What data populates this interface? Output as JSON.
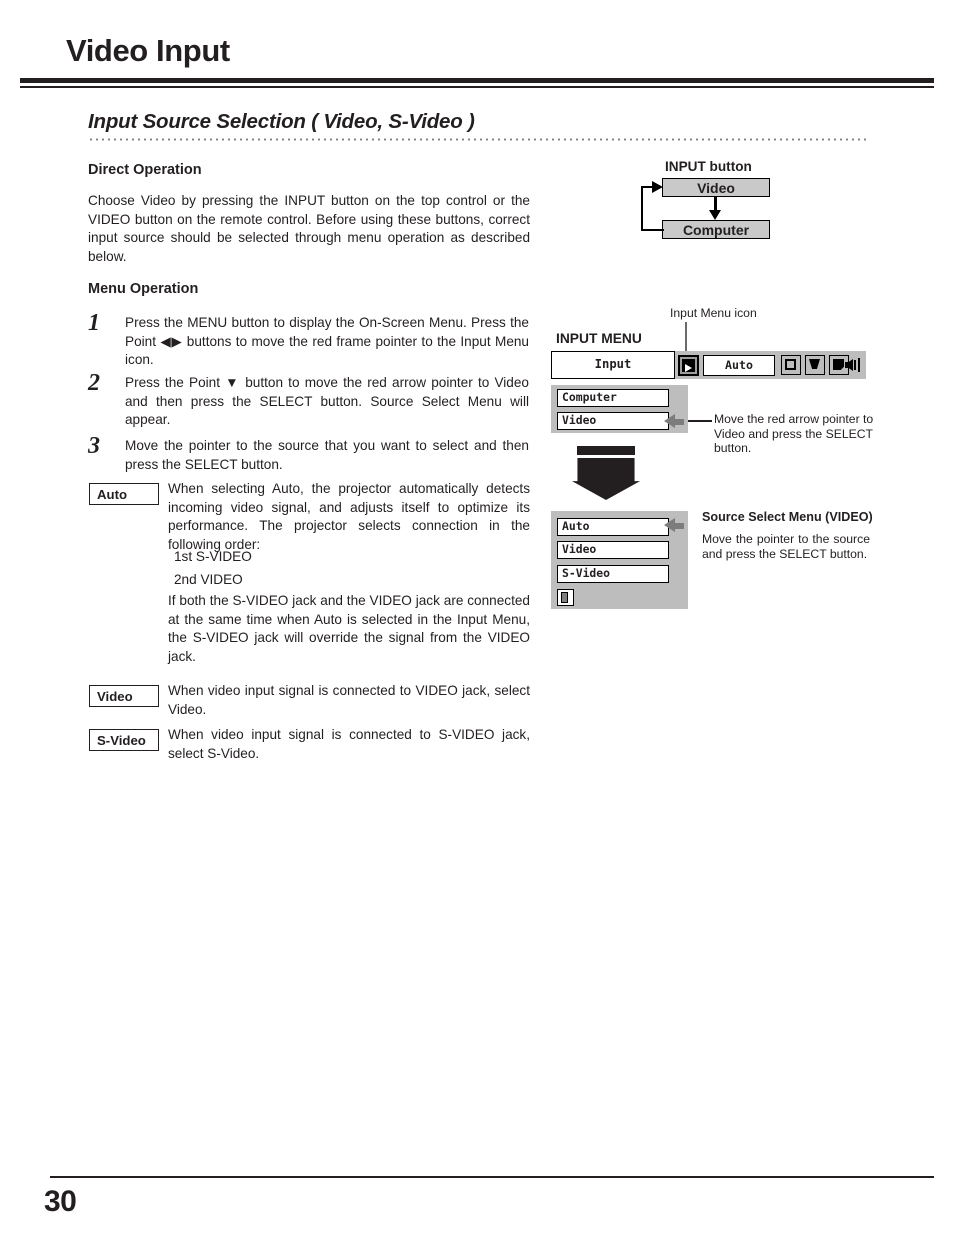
{
  "page": {
    "title": "Video Input",
    "number": "30"
  },
  "section": {
    "heading": "Input Source Selection ( Video, S-Video )"
  },
  "direct_operation": {
    "heading": "Direct Operation",
    "text": "Choose Video by pressing the INPUT button on the top control or the VIDEO button on the remote control. Before using these buttons, correct input source should be selected through menu operation as described below."
  },
  "menu_operation": {
    "heading": "Menu Operation",
    "steps": [
      {
        "num": "1",
        "text": "Press the MENU button to display the On-Screen Menu.  Press the Point ◀▶ buttons to move the red frame pointer to the Input Menu icon."
      },
      {
        "num": "2",
        "text": "Press the Point ▼ button to move the red arrow pointer to Video and then press the SELECT button.  Source Select Menu will appear."
      },
      {
        "num": "3",
        "text": "Move the pointer to the source that you want to select and then press the SELECT button."
      }
    ]
  },
  "options": [
    {
      "label": "Auto",
      "text": "When selecting Auto, the projector automatically detects incoming video signal, and adjusts itself to optimize its performance. The projector selects connection in the following order:",
      "order_1": "1st S-VIDEO",
      "order_2": "2nd VIDEO",
      "text2": "If both the S-VIDEO jack and the VIDEO jack are connected at the same time when Auto is selected in the Input Menu, the S-VIDEO jack will override the signal from the VIDEO jack."
    },
    {
      "label": "Video",
      "text": "When video input signal is connected to VIDEO jack, select Video."
    },
    {
      "label": "S-Video",
      "text": "When video input signal is connected to S-VIDEO jack, select S-Video."
    }
  ],
  "input_button_diagram": {
    "caption": "INPUT button",
    "chips": [
      {
        "label": "Video"
      },
      {
        "label": "Computer"
      }
    ]
  },
  "input_menu_diagram": {
    "icon_caption": "Input Menu icon",
    "title": "INPUT MENU",
    "menubar": {
      "input_field": "Input",
      "auto_field": "Auto",
      "icons": [
        "input-menu-icon",
        "screen-icon",
        "color-adjust-icon",
        "image-icon",
        "sound-icon"
      ]
    },
    "submenu_rows": [
      {
        "label": "Computer"
      },
      {
        "label": "Video"
      }
    ],
    "callout": "Move the red arrow pointer to Video and press the SELECT button."
  },
  "source_select_menu": {
    "title": "Source Select Menu (VIDEO)",
    "description": "Move the pointer to the source and press the SELECT button.",
    "rows": [
      {
        "label": "Auto"
      },
      {
        "label": "Video"
      },
      {
        "label": "S-Video"
      }
    ],
    "exit_icon": "exit-door-icon"
  },
  "colors": {
    "ink": "#231f20",
    "osd_gray": "#bdbdbd",
    "chip_gray": "#c9c9c9",
    "pointer_gray": "#7c7c7c"
  }
}
